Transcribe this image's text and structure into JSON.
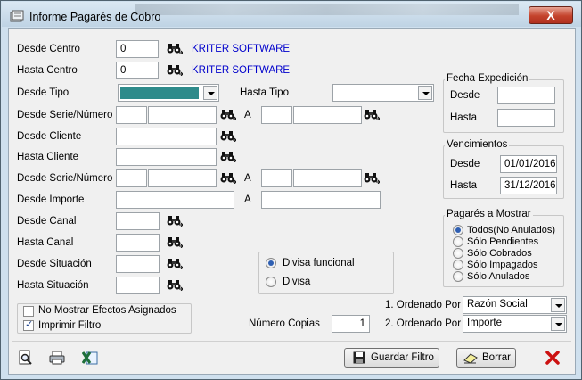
{
  "window": {
    "title": "Informe Pagarés de Cobro",
    "close_symbol": "X"
  },
  "fields": {
    "desde_centro": {
      "label": "Desde Centro",
      "value": "0",
      "link": "KRITER SOFTWARE"
    },
    "hasta_centro": {
      "label": "Hasta Centro",
      "value": "0",
      "link": "KRITER SOFTWARE"
    },
    "desde_tipo": {
      "label": "Desde Tipo",
      "value": ""
    },
    "hasta_tipo": {
      "label": "Hasta Tipo",
      "value": ""
    },
    "desde_serie_numero_1": {
      "label": "Desde Serie/Número",
      "separator": "A"
    },
    "desde_cliente": {
      "label": "Desde Cliente",
      "value": ""
    },
    "hasta_cliente": {
      "label": "Hasta Cliente",
      "value": ""
    },
    "desde_serie_numero_2": {
      "label": "Desde Serie/Número",
      "separator": "A"
    },
    "desde_importe": {
      "label": "Desde Importe",
      "separator": "A"
    },
    "desde_canal": {
      "label": "Desde Canal",
      "value": ""
    },
    "hasta_canal": {
      "label": "Hasta Canal",
      "value": ""
    },
    "desde_situacion": {
      "label": "Desde Situación",
      "value": ""
    },
    "hasta_situacion": {
      "label": "Hasta Situación",
      "value": ""
    }
  },
  "fecha_expedicion": {
    "title": "Fecha Expedición",
    "desde_label": "Desde",
    "hasta_label": "Hasta",
    "desde_value": "",
    "hasta_value": ""
  },
  "vencimientos": {
    "title": "Vencimientos",
    "desde_label": "Desde",
    "hasta_label": "Hasta",
    "desde_value": "01/01/2016",
    "hasta_value": "31/12/2016"
  },
  "pagares": {
    "title": "Pagarés a Mostrar",
    "options": [
      "Todos(No Anulados)",
      "Sólo Pendientes",
      "Sólo Cobrados",
      "Sólo Impagados",
      "Sólo Anulados"
    ],
    "selected_index": 0
  },
  "divisa": {
    "options": [
      "Divisa funcional",
      "Divisa"
    ],
    "selected_index": 0
  },
  "checks": {
    "no_mostrar": {
      "label": "No Mostrar Efectos Asignados",
      "checked": false
    },
    "imprimir": {
      "label": "Imprimir Filtro",
      "checked": true
    }
  },
  "copias": {
    "label": "Número Copias",
    "value": "1"
  },
  "orden": {
    "label1": "1. Ordenado Por",
    "value1": "Razón Social",
    "label2": "2. Ordenado Por",
    "value2": "Importe"
  },
  "buttons": {
    "guardar": "Guardar Filtro",
    "borrar": "Borrar"
  },
  "icons": {
    "binoculars": "binoculars-icon",
    "preview": "print-preview-icon",
    "print": "printer-icon",
    "excel": "excel-icon",
    "save": "floppy-icon",
    "eraser": "eraser-icon",
    "exit": "red-x-icon"
  },
  "colors": {
    "selected_tipo": "#2e8b8b",
    "link": "#0000cc",
    "exit": "#cc1111"
  }
}
